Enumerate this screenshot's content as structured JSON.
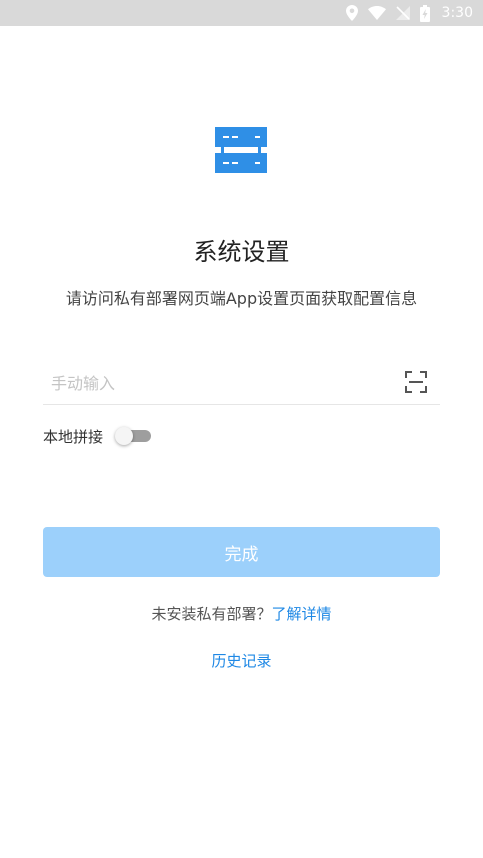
{
  "status_bar": {
    "time": "3:30",
    "icons": [
      "location-icon",
      "wifi-icon",
      "no-signal-icon",
      "battery-charging-icon"
    ]
  },
  "colors": {
    "accent": "#1e88e5",
    "logo": "#2f8fe6",
    "button_disabled": "#9cd0fb",
    "status_bar": "#d9d9d9"
  },
  "header": {
    "logo_icon": "server-icon",
    "title": "系统设置",
    "subtitle": "请访问私有部署网页端App设置页面获取配置信息"
  },
  "form": {
    "input_value": "",
    "input_placeholder": "手动输入",
    "scan_icon": "scan-icon",
    "toggle_label": "本地拼接",
    "toggle_on": false,
    "done_label": "完成"
  },
  "footer": {
    "not_installed_text": "未安装私有部署？",
    "learn_more_label": "了解详情",
    "history_label": "历史记录"
  }
}
